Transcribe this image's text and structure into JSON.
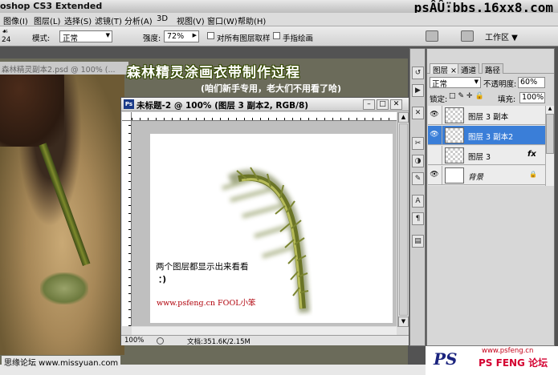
{
  "titlebar": {
    "app_title": "oshop CS3 Extended",
    "watermark": "psÂÛ̈:bbs.16xx8.com"
  },
  "menu": [
    "图像(I)",
    "图层(L)",
    "选择(S)",
    "滤镜(T)",
    "分析(A)",
    "3D",
    "视图(V)",
    "窗口(W)",
    "帮助(H)"
  ],
  "options": {
    "brush_size": "24",
    "mode_label": "模式:",
    "mode_value": "正常",
    "strength_label": "强度:",
    "strength_value": "72%",
    "sample_all_label": "对所有图层取样",
    "finger_paint_label": "手指绘画",
    "workspace_label": "工作区 ▼"
  },
  "bg_doc": {
    "title": "森林精灵副本2.psd @ 100% (..."
  },
  "banner": {
    "title": "森林精灵涂画衣带制作过程",
    "subtitle": "(咱们新手专用，老大们不用看了哈)"
  },
  "doc_window": {
    "title": "未标题-2 @ 100% (图层 3 副本2, RGB/8)",
    "badge": "Ps",
    "text_line1": "两个图层都显示出来看看",
    "text_line2": "：)",
    "url_text": "www.psfeng.cn   FOOL小笨",
    "zoom": "100%",
    "doc_size": "文档:351.6K/2.15M"
  },
  "tools": [
    "↺",
    "▶",
    "✕",
    "✂",
    "◑",
    "✎",
    "A",
    "¶",
    "▤"
  ],
  "layers_panel": {
    "tabs": [
      "图层 ×",
      "通道",
      "路径"
    ],
    "blend_mode": "正常",
    "opacity_label": "不透明度:",
    "opacity_value": "60%",
    "lock_label": "锁定:",
    "fill_label": "填充:",
    "fill_value": "100%",
    "layers": [
      {
        "name": "图层 3 副本",
        "visible": true,
        "selected": false
      },
      {
        "name": "图层 3 副本2",
        "visible": true,
        "selected": true
      },
      {
        "name": "图层 3",
        "visible": false,
        "selected": false,
        "fx": "fx"
      },
      {
        "name": "背景",
        "visible": true,
        "selected": false,
        "locked": true
      }
    ]
  },
  "footer": {
    "left_text": "思缘论坛  www.missyuan.com",
    "right_url": "www.psfeng.cn",
    "right_name": "PS FENG 论坛",
    "logo": "PS"
  },
  "colors": {
    "selection_blue": "#3a7ed8",
    "url_red": "#b0000a"
  }
}
